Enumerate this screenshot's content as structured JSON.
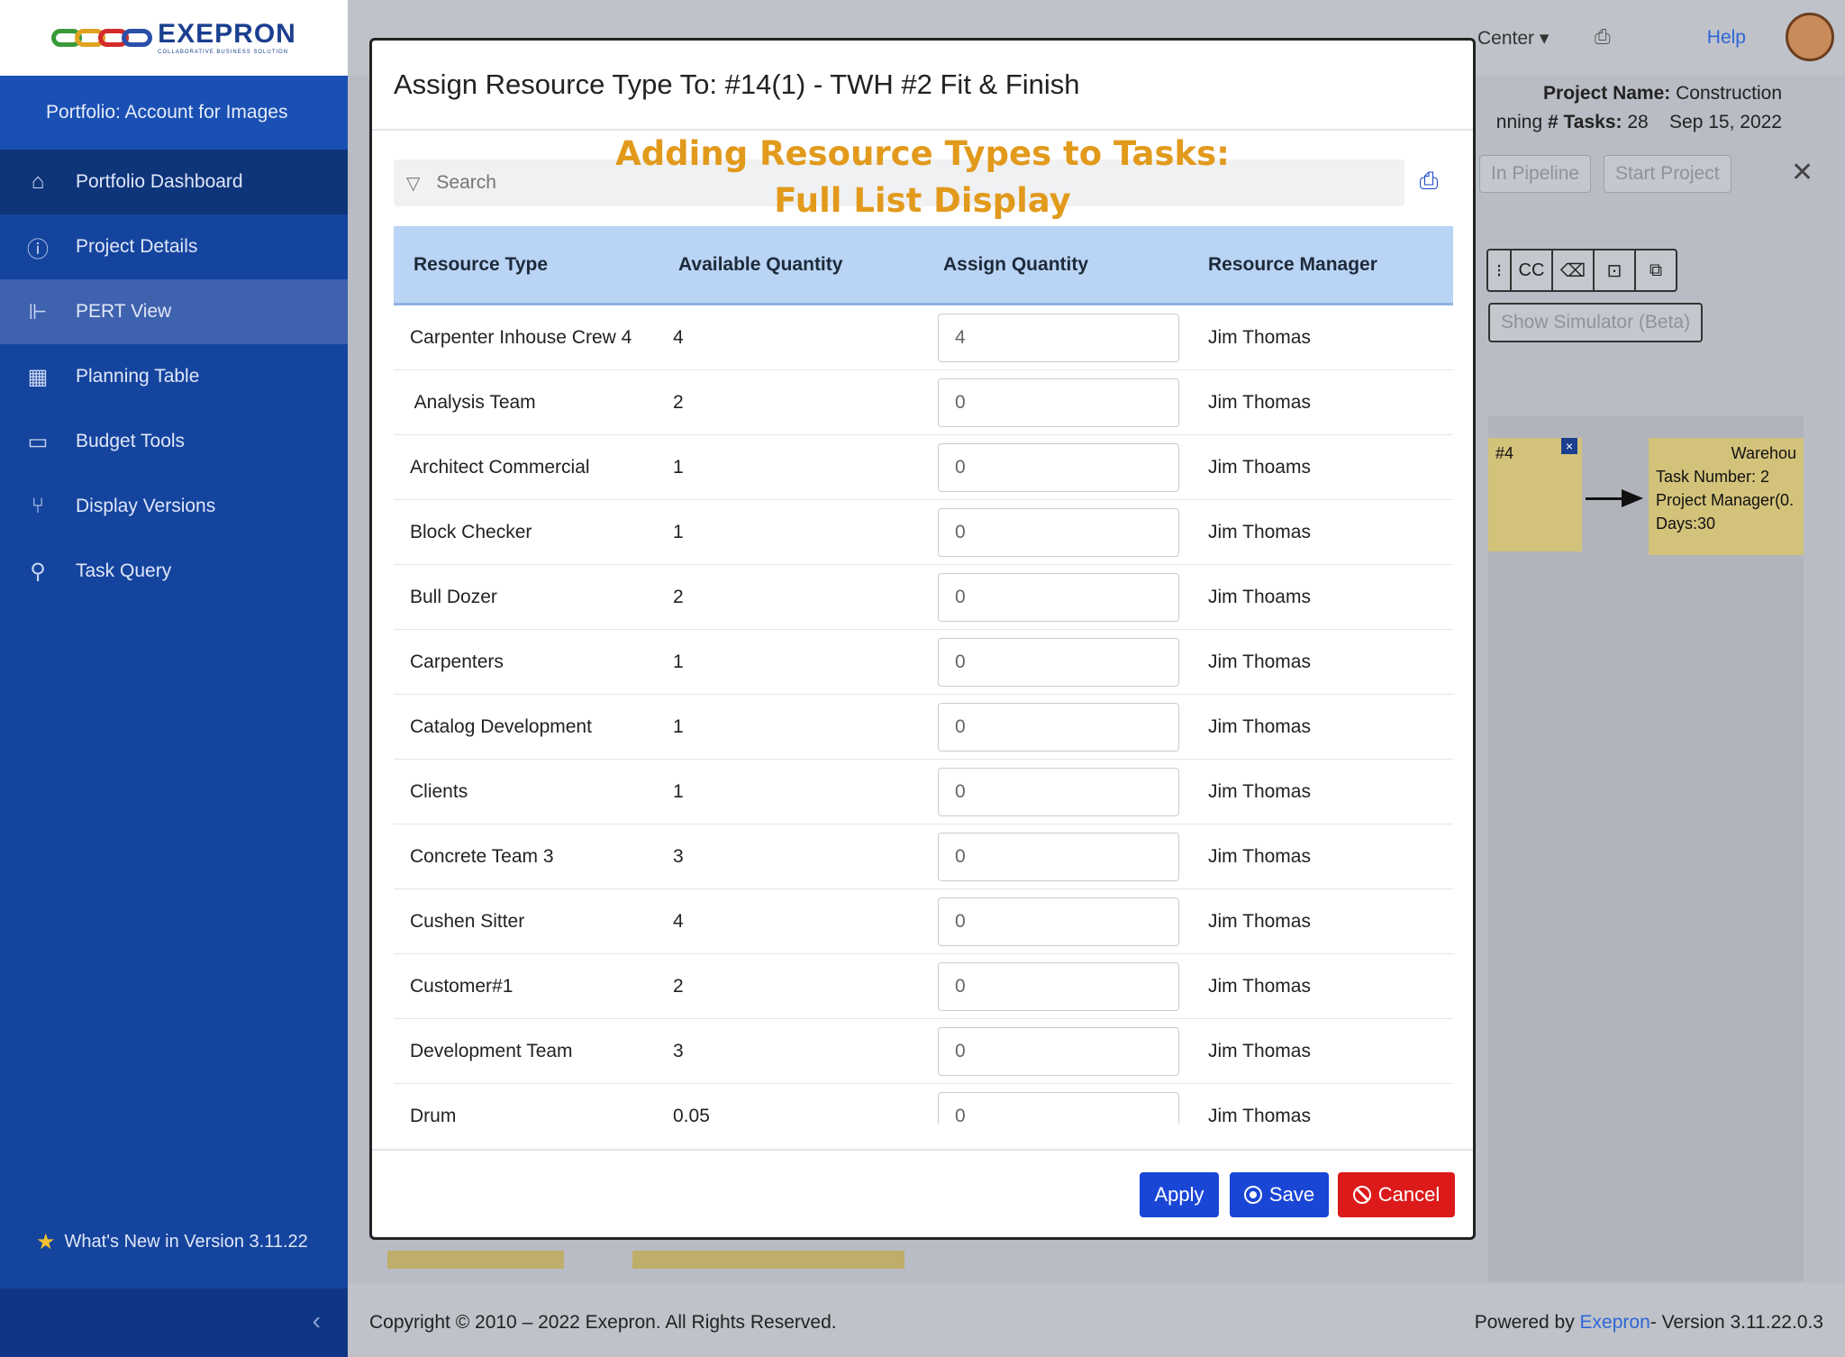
{
  "sidebar": {
    "logo_text": "EXEPRON",
    "logo_sub": "COLLABORATIVE BUSINESS SOLUTION",
    "portfolio": "Portfolio: Account for Images",
    "items": [
      {
        "label": "Portfolio Dashboard",
        "icon": "home-icon"
      },
      {
        "label": "Project Details",
        "icon": "info-icon"
      },
      {
        "label": "PERT View",
        "icon": "pert-icon"
      },
      {
        "label": "Planning Table",
        "icon": "table-icon"
      },
      {
        "label": "Budget Tools",
        "icon": "money-icon"
      },
      {
        "label": "Display Versions",
        "icon": "branch-icon"
      },
      {
        "label": "Task Query",
        "icon": "search-icon"
      }
    ],
    "whats_new": "What's New in Version  3.11.22"
  },
  "topbar": {
    "center_label": "Center",
    "help": "Help"
  },
  "project_info": {
    "name_label": "Project Name:",
    "name_value": "Construction",
    "tasks_prefix": "nning",
    "tasks_label": "# Tasks:",
    "tasks_value": "28",
    "date": "Sep 15, 2022"
  },
  "background": {
    "in_pipeline": "In Pipeline",
    "start_project": "Start Project",
    "show_simulator": "Show Simulator (Beta)",
    "toolbar_cc": "CC",
    "node_left_label": "#4",
    "node_right": {
      "title": "Warehou",
      "task_number": "Task Number: 2",
      "manager": "Project Manager(0.",
      "days": "Days:30"
    }
  },
  "modal": {
    "title": "Assign Resource Type To: #14(1) - TWH #2 Fit & Finish",
    "overlay_line1": "Adding Resource Types to Tasks:",
    "overlay_line2": "Full List Display",
    "search_placeholder": "Search",
    "columns": [
      "Resource Type",
      "Available Quantity",
      "Assign Quantity",
      "Resource Manager"
    ],
    "rows": [
      {
        "type": "Carpenter Inhouse Crew 4",
        "available": "4",
        "assign": "4",
        "manager": "Jim Thomas"
      },
      {
        "type": " Analysis Team",
        "available": "2",
        "assign": "0",
        "manager": "Jim Thomas"
      },
      {
        "type": "Architect Commercial",
        "available": "1",
        "assign": "0",
        "manager": "Jim Thoams"
      },
      {
        "type": "Block Checker",
        "available": "1",
        "assign": "0",
        "manager": "Jim Thomas"
      },
      {
        "type": "Bull Dozer",
        "available": "2",
        "assign": "0",
        "manager": "Jim Thoams"
      },
      {
        "type": "Carpenters",
        "available": "1",
        "assign": "0",
        "manager": "Jim Thomas"
      },
      {
        "type": "Catalog Development",
        "available": "1",
        "assign": "0",
        "manager": "Jim Thomas"
      },
      {
        "type": "Clients",
        "available": "1",
        "assign": "0",
        "manager": "Jim Thomas"
      },
      {
        "type": "Concrete Team 3",
        "available": "3",
        "assign": "0",
        "manager": "Jim Thomas"
      },
      {
        "type": "Cushen Sitter",
        "available": "4",
        "assign": "0",
        "manager": "Jim Thomas"
      },
      {
        "type": "Customer#1",
        "available": "2",
        "assign": "0",
        "manager": "Jim Thomas"
      },
      {
        "type": "Development Team",
        "available": "3",
        "assign": "0",
        "manager": "Jim Thomas"
      },
      {
        "type": "Drum",
        "available": "0.05",
        "assign": "0",
        "manager": "Jim Thomas"
      }
    ],
    "buttons": {
      "apply": "Apply",
      "save": "Save",
      "cancel": "Cancel"
    }
  },
  "footer": {
    "copyright": "Copyright © 2010 – 2022 Exepron. All Rights Reserved.",
    "powered_prefix": "Powered by ",
    "powered_link": "Exepron",
    "powered_suffix": "- Version 3.11.22.0.3"
  },
  "colors": {
    "sidebar": "#15449e",
    "header_row": "#b9d4f4",
    "overlay_text": "#e29a1c",
    "primary_button": "#1a46d6",
    "cancel_button": "#dd1a1a"
  }
}
